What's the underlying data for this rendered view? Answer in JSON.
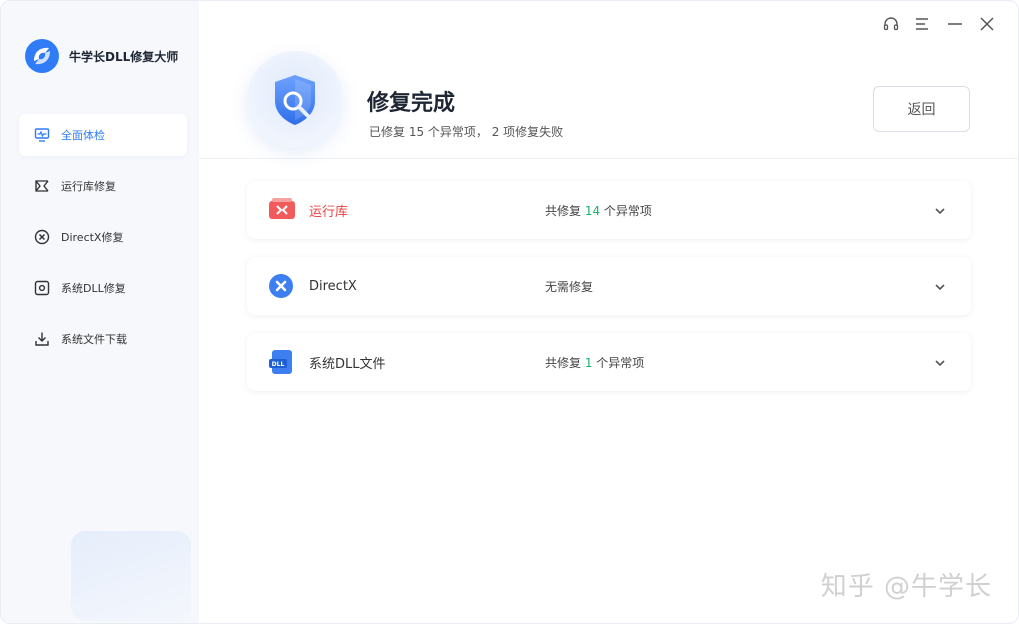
{
  "app": {
    "name": "牛学长DLL修复大师"
  },
  "sidebar": {
    "items": [
      {
        "label": "全面体检",
        "icon": "monitor-pulse-icon",
        "active": true
      },
      {
        "label": "运行库修复",
        "icon": "runtime-icon",
        "active": false
      },
      {
        "label": "DirectX修复",
        "icon": "x-circle-icon",
        "active": false
      },
      {
        "label": "系统DLL修复",
        "icon": "dll-gear-icon",
        "active": false
      },
      {
        "label": "系统文件下载",
        "icon": "download-icon",
        "active": false
      }
    ]
  },
  "header": {
    "title": "修复完成",
    "subtitle": "已修复 15 个异常项， 2 项修复失败",
    "back_label": "返回"
  },
  "results": [
    {
      "name": "运行库",
      "status_prefix": "共修复 ",
      "count": "14",
      "status_suffix": " 个异常项",
      "icon": "runtime-red-icon",
      "highlight": true
    },
    {
      "name": "DirectX",
      "status": "无需修复",
      "icon": "directx-icon",
      "highlight": false
    },
    {
      "name": "系统DLL文件",
      "status_prefix": "共修复 ",
      "count": "1",
      "status_suffix": " 个异常项",
      "icon": "dll-file-icon",
      "highlight": false
    }
  ],
  "watermark": "知乎 @牛学长",
  "colors": {
    "accent": "#2f7cf6",
    "success": "#19b36b",
    "warning": "#e84545"
  }
}
